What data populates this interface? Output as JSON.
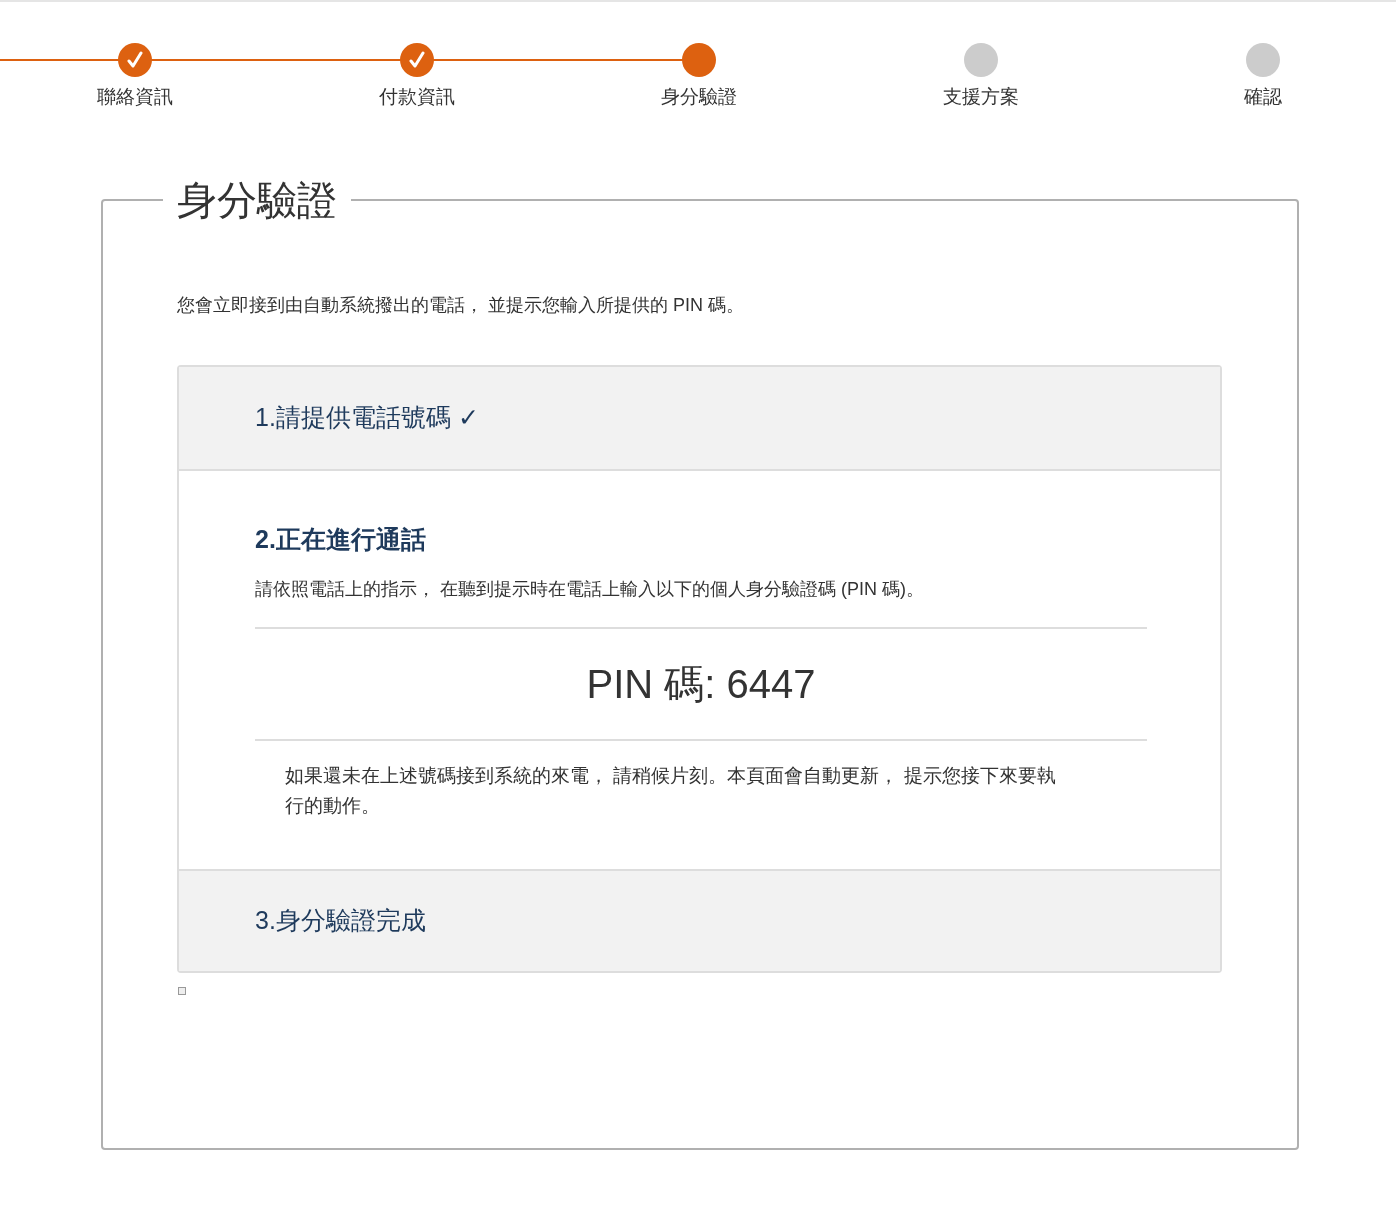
{
  "steps": [
    {
      "label": "聯絡資訊",
      "completed": true
    },
    {
      "label": "付款資訊",
      "completed": true
    },
    {
      "label": "身分驗證",
      "completed": false
    },
    {
      "label": "支援方案",
      "completed": false
    },
    {
      "label": "確認",
      "completed": false
    }
  ],
  "section": {
    "title": "身分驗證",
    "intro": "您會立即接到由自動系統撥出的電話， 並提示您輸入所提供的 PIN 碼。"
  },
  "panels": [
    {
      "title": "1.請提供電話號碼 ✓",
      "expanded": false
    },
    {
      "title": "2.正在進行通話",
      "expanded": true,
      "instruction": "請依照電話上的指示， 在聽到提示時在電話上輸入以下的個人身分驗證碼 (PIN 碼)。",
      "pin": "PIN 碼: 6447",
      "note": "如果還未在上述號碼接到系統的來電， 請稍候片刻。本頁面會自動更新， 提示您接下來要執行的動作。"
    },
    {
      "title": "3.身分驗證完成",
      "expanded": false
    }
  ]
}
